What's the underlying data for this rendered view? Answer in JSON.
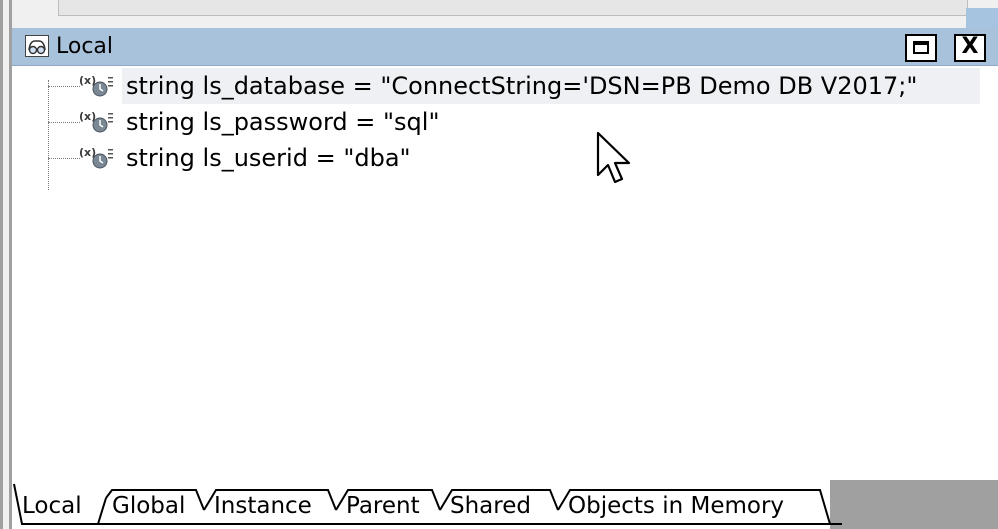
{
  "panel": {
    "title": "Local",
    "maximize_label": "",
    "close_label": "X"
  },
  "variables": [
    {
      "text": "string ls_database = \"ConnectString='DSN=PB Demo DB V2017;\"",
      "selected": true
    },
    {
      "text": "string ls_password = \"sql\"",
      "selected": false
    },
    {
      "text": "string ls_userid = \"dba\"",
      "selected": false
    }
  ],
  "tabs": [
    {
      "label": "Local",
      "active": true
    },
    {
      "label": "Global",
      "active": false
    },
    {
      "label": "Instance",
      "active": false
    },
    {
      "label": "Parent",
      "active": false
    },
    {
      "label": "Shared",
      "active": false
    },
    {
      "label": "Objects in Memory",
      "active": false
    }
  ],
  "icons": {
    "panel": "watch-glasses-icon",
    "variable": "variable-icon",
    "cursor": "mouse-pointer-icon"
  },
  "colors": {
    "titlebar": "#a8c2dc",
    "selected_row": "#eef0f4",
    "tab_strip_empty": "#a0a0a0"
  }
}
